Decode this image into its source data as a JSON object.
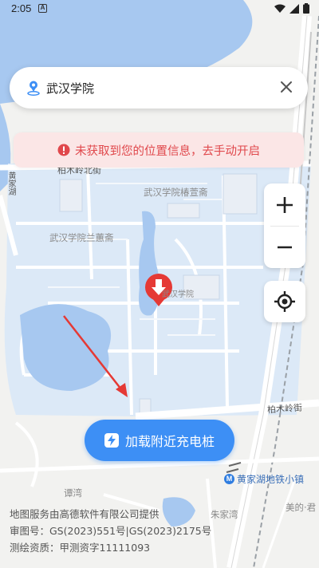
{
  "status_bar": {
    "time": "2:05",
    "badge": "A"
  },
  "search": {
    "value": "武汉学院"
  },
  "warning": {
    "text": "未获取到您的位置信息，去手动开启"
  },
  "map_labels": {
    "campus_top": "武汉学院椿萱斋",
    "campus_left": "武汉学院兰蕙斋",
    "campus_mid": "武汉学院",
    "road_top": "柏木岭北街",
    "road_bottom": "柏木岭街",
    "metro": "黄家湖地铁小镇",
    "place_1": "谭湾",
    "place_2": "朱家湾",
    "place_3": "美的·君",
    "road_left": "黄家湖"
  },
  "load_button": {
    "label": "加载附近充电桩"
  },
  "footer": {
    "line1": "地图服务由高德软件有限公司提供",
    "line2": "审图号：GS(2023)551号|GS(2023)2175号",
    "line3": "测绘资质：甲测资字11111093"
  },
  "colors": {
    "accent": "#3d8ff5",
    "warning_text": "#e0484c",
    "warning_bg": "#fbe6e6",
    "water": "#a7c8f0",
    "campus": "#dce9f7",
    "marker": "#e53935"
  }
}
